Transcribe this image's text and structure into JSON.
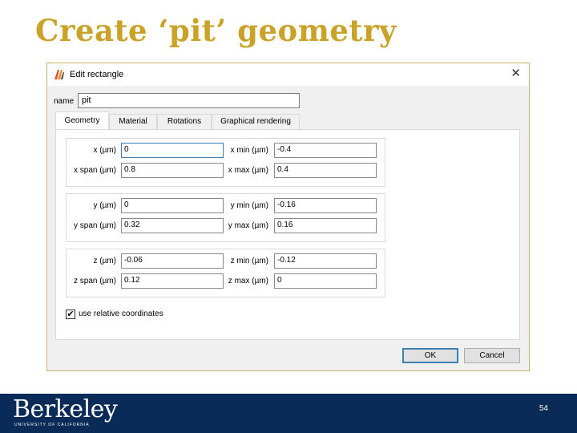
{
  "slide": {
    "title": "Create ‘pit’ geometry",
    "page_number": "54"
  },
  "dialog": {
    "title": "Edit rectangle",
    "close_label": "✕",
    "name_label": "name",
    "name_value": "pit",
    "tabs": [
      "Geometry",
      "Material",
      "Rotations",
      "Graphical rendering"
    ],
    "active_tab": "Geometry",
    "groups": [
      {
        "fields": [
          {
            "label": "x (µm)",
            "value": "0"
          },
          {
            "label": "x min (µm)",
            "value": "-0.4"
          },
          {
            "label": "x span (µm)",
            "value": "0.8"
          },
          {
            "label": "x max (µm)",
            "value": "0.4"
          }
        ]
      },
      {
        "fields": [
          {
            "label": "y (µm)",
            "value": "0"
          },
          {
            "label": "y min (µm)",
            "value": "-0.16"
          },
          {
            "label": "y span (µm)",
            "value": "0.32"
          },
          {
            "label": "y max (µm)",
            "value": "0.16"
          }
        ]
      },
      {
        "fields": [
          {
            "label": "z (µm)",
            "value": "-0.06"
          },
          {
            "label": "z min (µm)",
            "value": "-0.12"
          },
          {
            "label": "z span (µm)",
            "value": "0.12"
          },
          {
            "label": "z max (µm)",
            "value": "0"
          }
        ]
      }
    ],
    "checkbox": {
      "label": "use relative coordinates",
      "checked": true,
      "mark": "✔"
    },
    "ok_label": "OK",
    "cancel_label": "Cancel"
  },
  "footer": {
    "logo_text": "Berkeley",
    "logo_subtext": "UNIVERSITY OF CALIFORNIA"
  },
  "colors": {
    "title": "#c9a227",
    "footer": "#0a2b57",
    "focus": "#3c7fb1"
  }
}
